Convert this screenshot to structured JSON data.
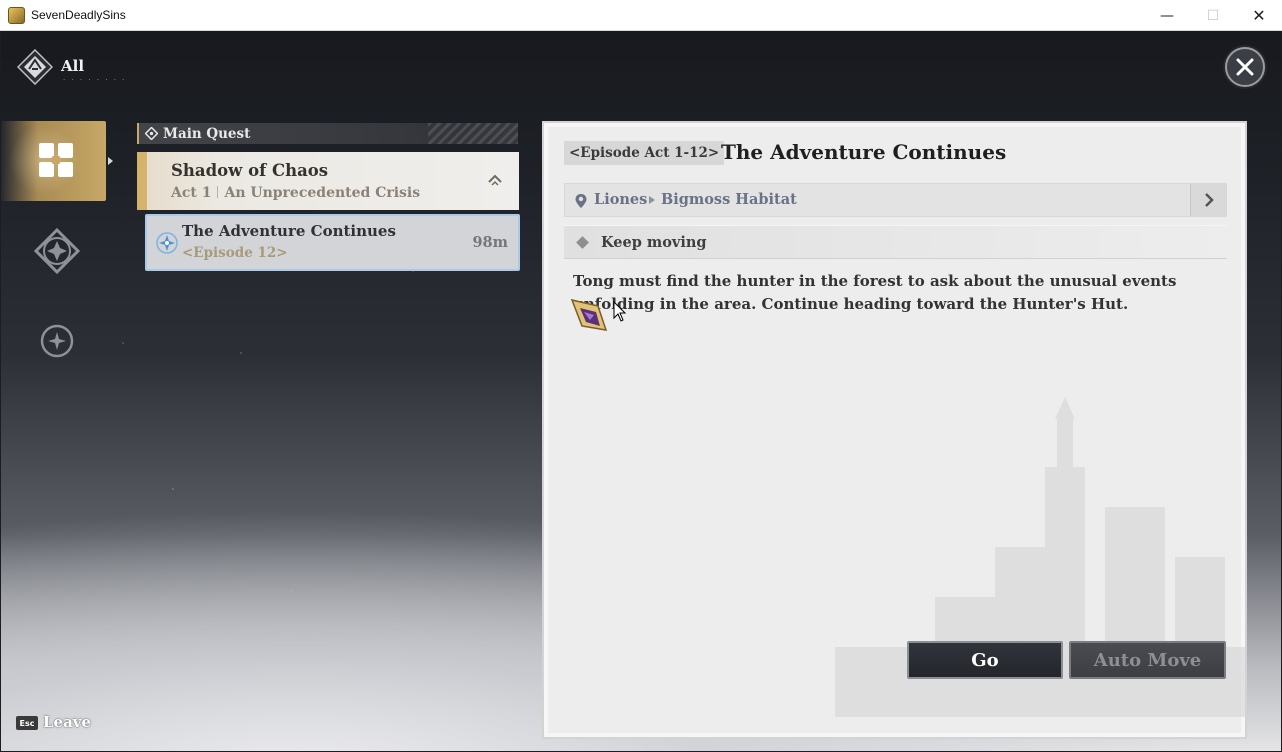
{
  "window": {
    "title": "SevenDeadlySins",
    "min_glyph": "—",
    "max_glyph": "☐",
    "close_glyph": "✕"
  },
  "header": {
    "label": "All",
    "subtitle": "· · · · · · · ·"
  },
  "nav": {
    "items": [
      {
        "name": "quest-category-all",
        "icon": "four-petal-icon",
        "active": true
      },
      {
        "name": "quest-category-side",
        "icon": "star-compass-icon",
        "active": false
      },
      {
        "name": "quest-category-other",
        "icon": "sparkle-circle-icon",
        "active": false
      }
    ]
  },
  "quest_list": {
    "section_label": "Main Quest",
    "chapter": {
      "title": "Shadow of Chaos",
      "act": "Act 1",
      "act_title": "An Unprecedented Crisis"
    },
    "selected_quest": {
      "title": "The Adventure Continues",
      "episode": "<Episode 12>",
      "distance": "98m"
    }
  },
  "details": {
    "episode_tag": "<Episode Act 1-12>",
    "title": "The Adventure Continues",
    "location": [
      "Liones",
      "Bigmoss Habitat"
    ],
    "objective": "Keep moving",
    "description": "Tong must find the hunter in the forest to ask about the unusual events unfolding in the area. Continue heading toward the Hunter's Hut.",
    "buttons": {
      "go": "Go",
      "auto_move": "Auto Move"
    }
  },
  "footer": {
    "esc_key": "Esc",
    "leave": "Leave"
  },
  "colors": {
    "accent_gold": "#c7a866",
    "selected_border": "#a9cbe9",
    "panel_bg": "#ededed",
    "location_text": "#6a7286"
  }
}
